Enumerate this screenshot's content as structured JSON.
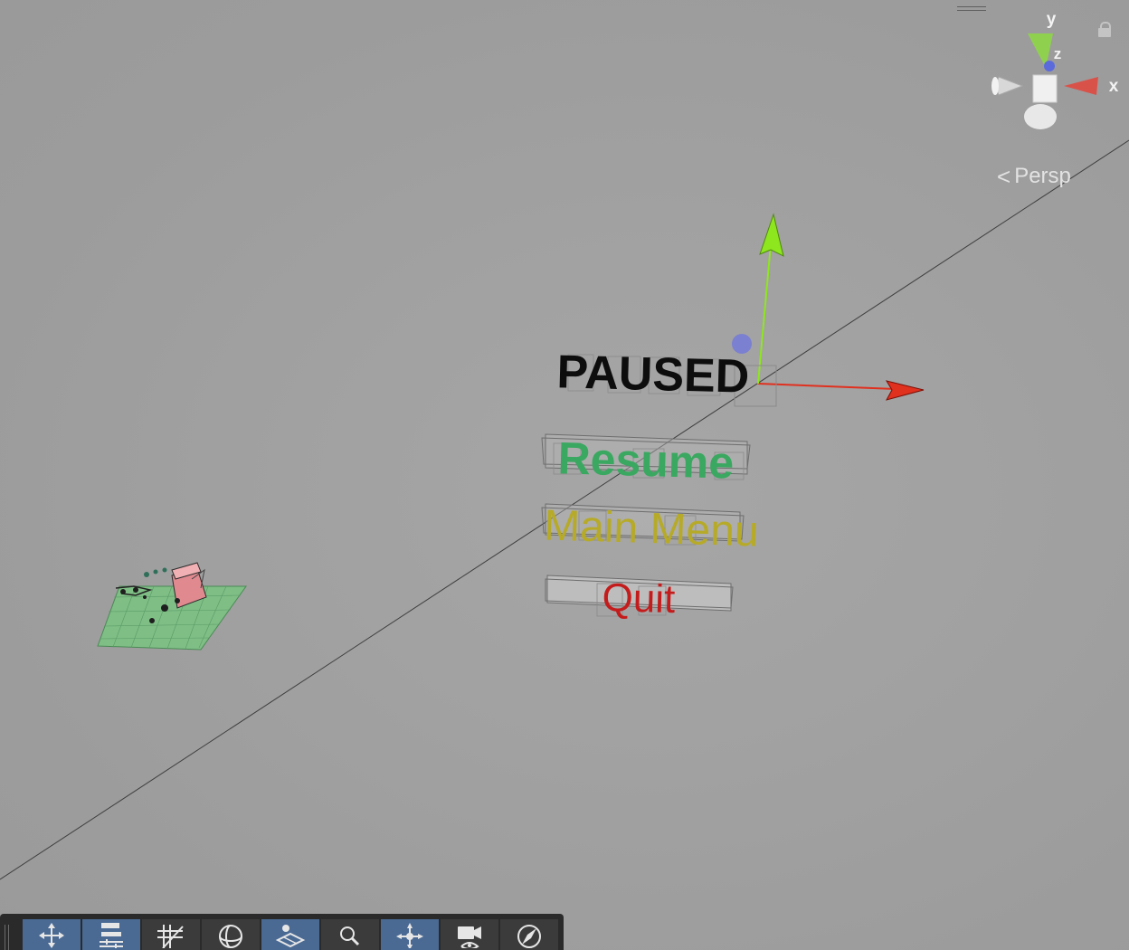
{
  "scene": {
    "paused_title": "PAUSED",
    "buttons": [
      {
        "label": "Resume",
        "color": "#3aa860"
      },
      {
        "label": "Main Menu",
        "color": "#b6aa28"
      },
      {
        "label": "Quit",
        "color": "#c41c1c"
      }
    ]
  },
  "gizmo": {
    "axis_x": "x",
    "axis_y": "y",
    "axis_z": "z",
    "x_color": "#d9524a",
    "y_color": "#8fd14f",
    "z_color": "#5b6bdc"
  },
  "view_mode": "Persp",
  "move_handle": {
    "x_color": "#e0301e",
    "y_color": "#8ee61e",
    "center_color": "#7b80d0"
  },
  "overlay_toolbar": {
    "buttons": [
      {
        "icon": "move-tool-icon",
        "active": true
      },
      {
        "icon": "pivot-tool-icon",
        "active": true
      },
      {
        "icon": "grid-snap-icon",
        "active": false
      },
      {
        "icon": "globe-icon",
        "active": false
      },
      {
        "icon": "layers-icon",
        "active": true
      },
      {
        "icon": "search-icon",
        "active": false
      },
      {
        "icon": "crosshair-icon",
        "active": true
      },
      {
        "icon": "camera-icon",
        "active": false
      },
      {
        "icon": "compass-icon",
        "active": false
      }
    ]
  }
}
